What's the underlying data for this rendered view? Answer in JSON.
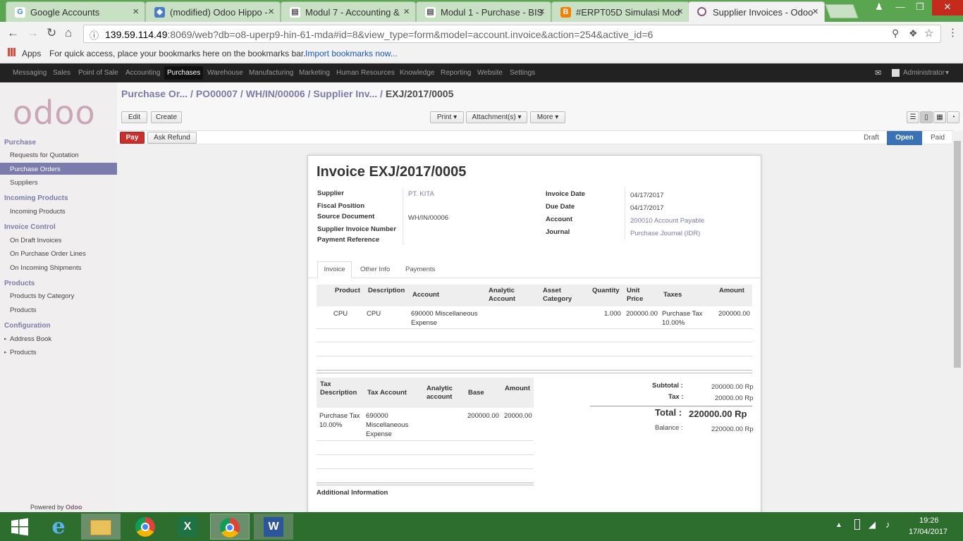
{
  "browser": {
    "tabs": [
      {
        "title": "Google Accounts",
        "icon": "G",
        "color": "#4285f4"
      },
      {
        "title": "(modified) Odoo Hippo -",
        "icon": "◆",
        "color": "#4a7cc7"
      },
      {
        "title": "Modul 7 - Accounting &",
        "icon": "▤",
        "color": "#555"
      },
      {
        "title": "Modul 1 - Purchase - BIS",
        "icon": "▤",
        "color": "#555"
      },
      {
        "title": "#ERPT05D Simulasi Mod",
        "icon": "B",
        "color": "#f57d00"
      },
      {
        "title": "Supplier Invoices - Odoo",
        "icon": "O",
        "color": "#875a7b"
      }
    ],
    "url_host": "139.59.114.49",
    "url_rest": ":8069/web?db=o8-uperp9-hin-61-mda#id=8&view_type=form&model=account.invoice&action=254&active_id=6",
    "bookmarks_apps": "Apps",
    "bookmarks_text": "For quick access, place your bookmarks here on the bookmarks bar.",
    "bookmarks_link": "Import bookmarks now..."
  },
  "topnav": {
    "items": [
      "Messaging",
      "Sales",
      "Point of Sale",
      "Accounting",
      "Purchases",
      "Warehouse",
      "Manufacturing",
      "Marketing",
      "Human Resources",
      "Knowledge",
      "Reporting",
      "Website",
      "Settings"
    ],
    "user": "Administrator"
  },
  "sidebar": {
    "logo": "odoo",
    "sections": [
      {
        "title": "Purchase",
        "items": [
          "Requests for Quotation",
          "Purchase Orders",
          "Suppliers"
        ]
      },
      {
        "title": "Incoming Products",
        "items": [
          "Incoming Products"
        ]
      },
      {
        "title": "Invoice Control",
        "items": [
          "On Draft Invoices",
          "On Purchase Order Lines",
          "On Incoming Shipments"
        ]
      },
      {
        "title": "Products",
        "items": [
          "Products by Category",
          "Products"
        ]
      },
      {
        "title": "Configuration",
        "items": [
          "Address Book",
          "Products"
        ]
      }
    ],
    "footer_prefix": "Powered by",
    "footer_brand": "Odoo"
  },
  "breadcrumb": {
    "items": [
      "Purchase Or...",
      "PO00007",
      "WH/IN/00006",
      "Supplier Inv..."
    ],
    "current": "EXJ/2017/0005"
  },
  "toolbar": {
    "edit": "Edit",
    "create": "Create",
    "print": "Print",
    "attachments": "Attachment(s)",
    "more": "More",
    "pay": "Pay",
    "refund": "Ask Refund"
  },
  "status": {
    "stages": [
      "Draft",
      "Open",
      "Paid"
    ],
    "current": "Open"
  },
  "invoice": {
    "title_prefix": "Invoice",
    "number": "EXJ/2017/0005",
    "labels_left": [
      "Supplier",
      "Fiscal Position",
      "Source Document",
      "Supplier Invoice Number",
      "Payment Reference"
    ],
    "supplier": "PT. KITA",
    "source_document": "WH/IN/00006",
    "labels_right": [
      "Invoice Date",
      "Due Date",
      "Account",
      "Journal"
    ],
    "invoice_date": "04/17/2017",
    "due_date": "04/17/2017",
    "account": "200010 Account Payable",
    "journal": "Purchase Journal (IDR)",
    "tabs": [
      "Invoice",
      "Other Info",
      "Payments"
    ]
  },
  "lines": {
    "headers": [
      "Product",
      "Description",
      "Account",
      "Analytic Account",
      "Asset Category",
      "Quantity",
      "Unit Price",
      "Taxes",
      "Amount"
    ],
    "rows": [
      {
        "product": "CPU",
        "description": "CPU",
        "account": "690000 Miscellaneous Expense",
        "analytic": "",
        "asset": "",
        "quantity": "1.000",
        "unit_price": "200000.00",
        "taxes": "Purchase Tax 10.00%",
        "amount": "200000.00"
      }
    ]
  },
  "taxes": {
    "headers": [
      "Tax Description",
      "Tax Account",
      "Analytic account",
      "Base",
      "Amount"
    ],
    "rows": [
      {
        "description": "Purchase Tax 10.00%",
        "account": "690000 Miscellaneous Expense",
        "analytic": "",
        "base": "200000.00",
        "amount": "20000.00"
      }
    ]
  },
  "totals": {
    "subtotal_label": "Subtotal :",
    "subtotal": "200000.00 Rp",
    "tax_label": "Tax :",
    "tax": "20000.00 Rp",
    "total_label": "Total :",
    "total": "220000.00 Rp",
    "balance_label": "Balance :",
    "balance": "220000.00 Rp"
  },
  "additional_info": "Additional Information",
  "taskbar": {
    "time": "19:26",
    "date": "17/04/2017"
  }
}
